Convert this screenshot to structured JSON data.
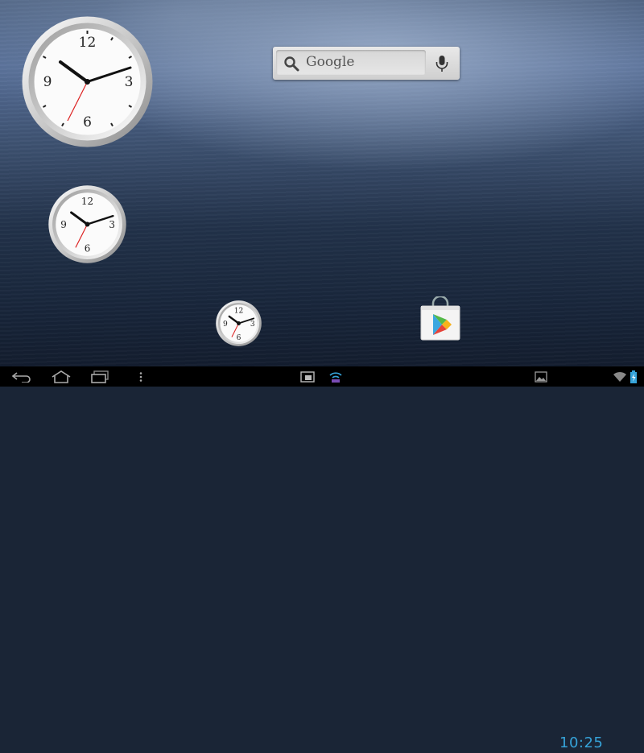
{
  "wallpaper": {
    "description": "brushed-metal blue"
  },
  "clocks": [
    {
      "name": "analog-clock-large",
      "numerals": [
        "12",
        "3",
        "6",
        "9"
      ]
    },
    {
      "name": "analog-clock-medium",
      "numerals": [
        "12",
        "3",
        "6",
        "9"
      ]
    },
    {
      "name": "analog-clock-small",
      "numerals": [
        "12",
        "3",
        "6",
        "9"
      ]
    }
  ],
  "search_widget": {
    "label": "Google",
    "search_icon": "search-icon",
    "voice_icon": "mic-icon"
  },
  "home_icons": [
    {
      "name": "play-store-icon"
    }
  ],
  "navbar": {
    "buttons": [
      "back-icon",
      "home-icon",
      "recent-apps-icon",
      "menu-icon"
    ],
    "notifications": [
      "screenshot-notification-icon",
      "wifi-notification-icon",
      "gallery-notification-icon"
    ],
    "status": {
      "time": "10:25",
      "icons": [
        "wifi-signal-icon",
        "battery-charging-icon"
      ]
    }
  },
  "colors": {
    "clock_time": "#36a3d9",
    "navbar": "#000000"
  }
}
